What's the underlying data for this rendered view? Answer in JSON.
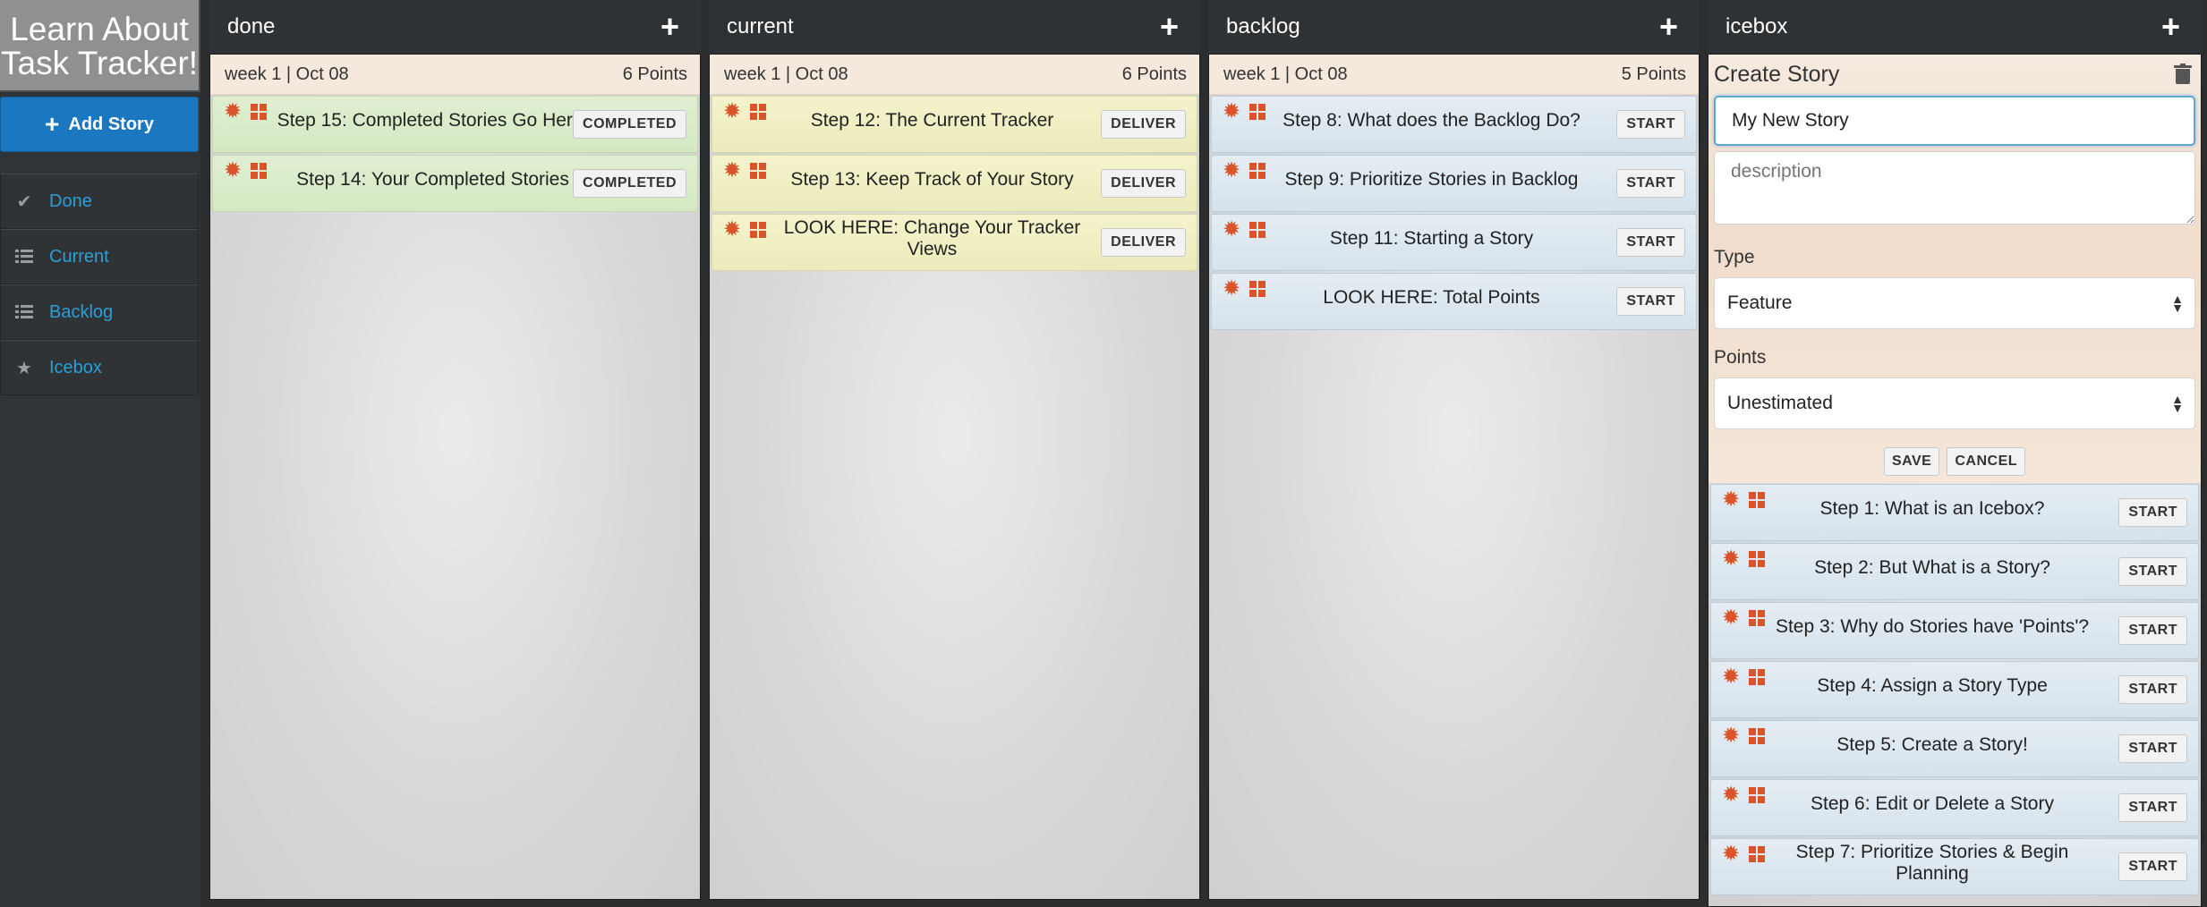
{
  "sidebar": {
    "logo_line1": "Learn About",
    "logo_line2": "Task Tracker!",
    "add_story_label": "Add Story",
    "items": [
      {
        "label": "Done",
        "icon": "checkmark-icon"
      },
      {
        "label": "Current",
        "icon": "list-icon"
      },
      {
        "label": "Backlog",
        "icon": "list-icon"
      },
      {
        "label": "Icebox",
        "icon": "star-icon"
      }
    ]
  },
  "columns": {
    "done": {
      "title": "done",
      "iteration": {
        "week": "week 1 | Oct 08",
        "points": "6 Points"
      },
      "stories": [
        {
          "title": "Step 15: Completed Stories Go Here!",
          "button": "COMPLETED"
        },
        {
          "title": "Step 14: Your Completed Stories",
          "button": "COMPLETED"
        }
      ]
    },
    "current": {
      "title": "current",
      "iteration": {
        "week": "week 1 | Oct 08",
        "points": "6 Points"
      },
      "stories": [
        {
          "title": "Step 12: The Current Tracker",
          "button": "DELIVER"
        },
        {
          "title": "Step 13: Keep Track of Your Story",
          "button": "DELIVER"
        },
        {
          "title": "LOOK HERE: Change Your Tracker Views",
          "button": "DELIVER"
        }
      ]
    },
    "backlog": {
      "title": "backlog",
      "iteration": {
        "week": "week 1 | Oct 08",
        "points": "5 Points"
      },
      "stories": [
        {
          "title": "Step 8: What does the Backlog Do?",
          "button": "START"
        },
        {
          "title": "Step 9: Prioritize Stories in Backlog",
          "button": "START"
        },
        {
          "title": "Step 11: Starting a Story",
          "button": "START"
        },
        {
          "title": "LOOK HERE: Total Points",
          "button": "START"
        }
      ]
    },
    "icebox": {
      "title": "icebox",
      "form": {
        "heading": "Create Story",
        "title_value": "My New Story",
        "description_placeholder": "description",
        "type_label": "Type",
        "type_value": "Feature",
        "points_label": "Points",
        "points_value": "Unestimated",
        "save_label": "SAVE",
        "cancel_label": "CANCEL"
      },
      "stories": [
        {
          "title": "Step 1: What is an Icebox?",
          "button": "START"
        },
        {
          "title": "Step 2: But What is a Story?",
          "button": "START"
        },
        {
          "title": "Step 3: Why do Stories have 'Points'?",
          "button": "START"
        },
        {
          "title": "Step 4: Assign a Story Type",
          "button": "START"
        },
        {
          "title": "Step 5: Create a Story!",
          "button": "START"
        },
        {
          "title": "Step 6: Edit or Delete a Story",
          "button": "START"
        },
        {
          "title": "Step 7: Prioritize Stories & Begin Planning",
          "button": "START"
        }
      ]
    }
  },
  "colors": {
    "add_story_blue": "#1b77c0",
    "nav_link_blue": "#2a9fd8",
    "story_icon_orange": "#d9542b",
    "done_story_green": "#d4e8c2",
    "current_story_yellow": "#ecebbc",
    "backlog_story_blue": "#d5e2ec"
  }
}
